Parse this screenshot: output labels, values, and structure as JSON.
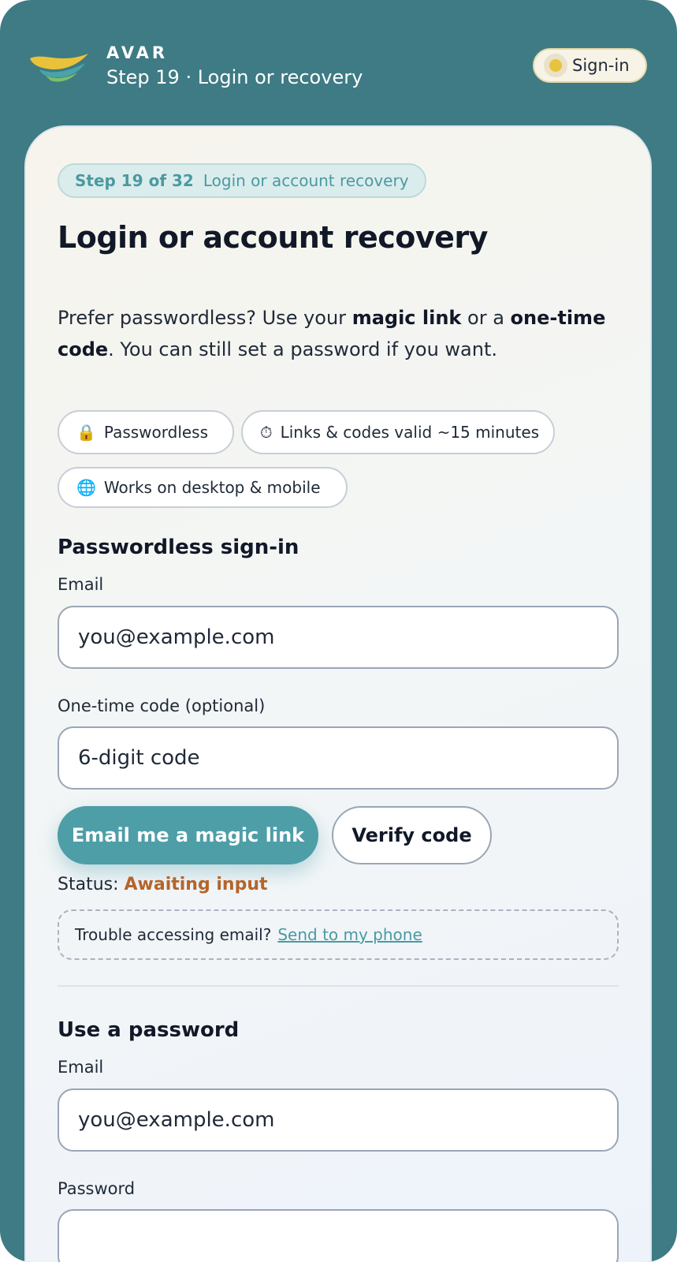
{
  "header": {
    "brand": "AVAR",
    "subtitle": "Step 19 · Login or recovery",
    "signin_label": "Sign-in"
  },
  "step": {
    "count": "Step 19 of 32",
    "description": "Login or account recovery"
  },
  "page": {
    "title": "Login or account recovery",
    "intro_pre": "Prefer passwordless? Use your ",
    "intro_bold1": "magic link",
    "intro_mid": " or a ",
    "intro_bold2": "one-time code",
    "intro_post": ". You can still set a password if you want."
  },
  "chips": [
    {
      "icon": "🔒",
      "label": "Passwordless"
    },
    {
      "icon": "⏱",
      "label": "Links & codes valid ~15 minutes"
    },
    {
      "icon": "🌐",
      "label": "Works on desktop & mobile"
    }
  ],
  "passwordless": {
    "title": "Passwordless sign-in",
    "email_label": "Email",
    "email_placeholder": "you@example.com",
    "code_label": "One-time code (optional)",
    "code_placeholder": "6-digit code",
    "magic_link_button": "Email me a magic link",
    "verify_button": "Verify code",
    "status_label": "Status: ",
    "status_value": "Awaiting input",
    "trouble_text": "Trouble accessing email?",
    "trouble_link": "Send to my phone"
  },
  "password": {
    "title": "Use a password",
    "email_label": "Email",
    "email_placeholder": "you@example.com",
    "password_label": "Password"
  },
  "colors": {
    "frame": "#3e7b84",
    "accent": "#4e9ea8",
    "status": "#b5642a"
  }
}
